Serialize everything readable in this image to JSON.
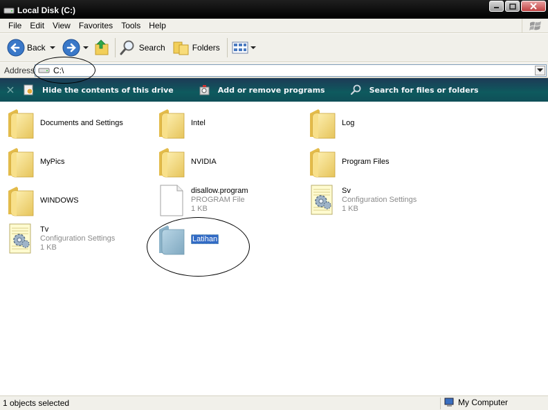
{
  "window": {
    "title": "Local Disk (C:)"
  },
  "menu": [
    "File",
    "Edit",
    "View",
    "Favorites",
    "Tools",
    "Help"
  ],
  "toolbar": {
    "back_label": "Back",
    "search_label": "Search",
    "folders_label": "Folders"
  },
  "address": {
    "label": "Address",
    "value": "C:\\"
  },
  "tasks": [
    {
      "label": "Hide the contents of this drive",
      "icon": "hide-drive-icon"
    },
    {
      "label": "Add or remove programs",
      "icon": "add-remove-programs-icon"
    },
    {
      "label": "Search for files or folders",
      "icon": "search-icon"
    }
  ],
  "items": [
    {
      "name": "Documents and Settings",
      "type": "folder"
    },
    {
      "name": "Intel",
      "type": "folder"
    },
    {
      "name": "Log",
      "type": "folder"
    },
    {
      "name": "MyPics",
      "type": "folder"
    },
    {
      "name": "NVIDIA",
      "type": "folder"
    },
    {
      "name": "Program Files",
      "type": "folder"
    },
    {
      "name": "WINDOWS",
      "type": "folder"
    },
    {
      "name": "disallow.program",
      "type": "file",
      "kind": "PROGRAM File",
      "size": "1 KB"
    },
    {
      "name": "Sv",
      "type": "config",
      "kind": "Configuration Settings",
      "size": "1 KB"
    },
    {
      "name": "Tv",
      "type": "config",
      "kind": "Configuration Settings",
      "size": "1 KB"
    },
    {
      "name": "Latihan",
      "type": "folder",
      "selected": true
    }
  ],
  "status": {
    "left": "1 objects selected",
    "right": "My Computer"
  },
  "colors": {
    "selection": "#316ac5",
    "taskbar": "#0e5a5e",
    "folder": "#f6d873"
  }
}
